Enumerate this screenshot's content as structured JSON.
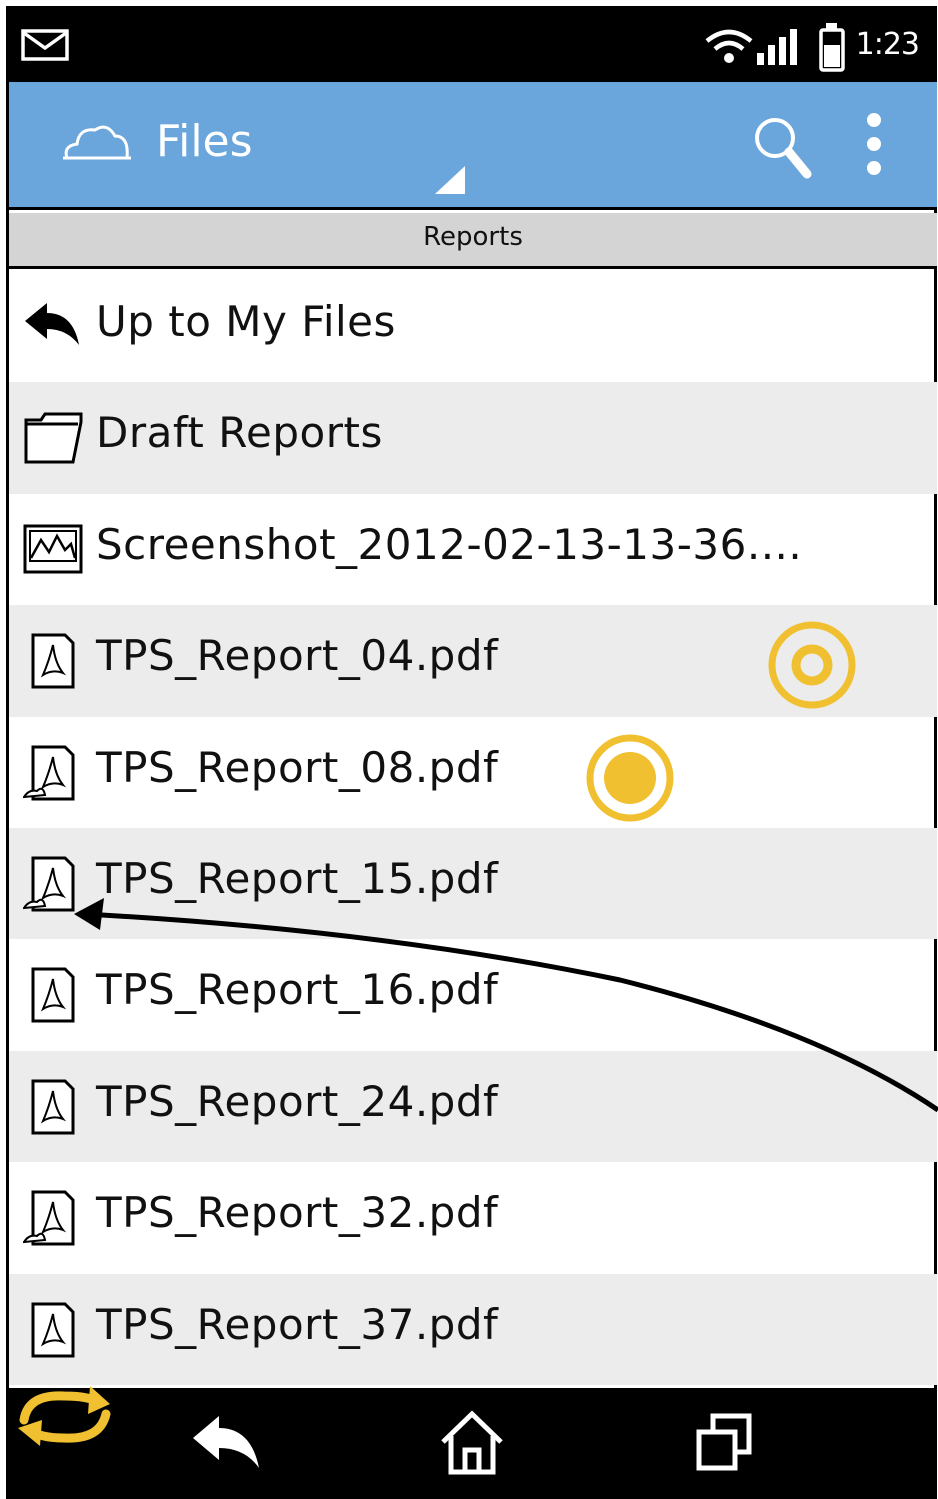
{
  "status_bar": {
    "time": "1:23",
    "icons": [
      "mail-icon",
      "wifi-icon",
      "signal-icon",
      "battery-icon"
    ]
  },
  "app_bar": {
    "title": "Files",
    "icons": [
      "cloud-icon",
      "dropdown-indicator-icon",
      "search-icon",
      "overflow-menu-icon"
    ]
  },
  "breadcrumb": {
    "label": "Reports"
  },
  "files": [
    {
      "label": "Up to My Files",
      "icon": "back-arrow-icon"
    },
    {
      "label": "Draft Reports",
      "icon": "folder-icon"
    },
    {
      "label": "Screenshot_2012-02-13-13-36....",
      "icon": "image-icon"
    },
    {
      "label": "TPS_Report_04.pdf",
      "icon": "pdf-icon"
    },
    {
      "label": "TPS_Report_08.pdf",
      "icon": "pdf-synced-icon"
    },
    {
      "label": "TPS_Report_15.pdf",
      "icon": "pdf-synced-icon"
    },
    {
      "label": "TPS_Report_16.pdf",
      "icon": "pdf-icon"
    },
    {
      "label": "TPS_Report_24.pdf",
      "icon": "pdf-icon"
    },
    {
      "label": "TPS_Report_32.pdf",
      "icon": "pdf-synced-icon"
    },
    {
      "label": "TPS_Report_37.pdf",
      "icon": "pdf-icon"
    }
  ],
  "nav_bar": {
    "icons": [
      "sync-icon",
      "back-icon",
      "home-icon",
      "recent-apps-icon"
    ]
  },
  "colors": {
    "app_bar": "#6aa6dc",
    "breadcrumb": "#d4d4d4",
    "alt_row": "#ececec",
    "accent": "#f0c030"
  }
}
